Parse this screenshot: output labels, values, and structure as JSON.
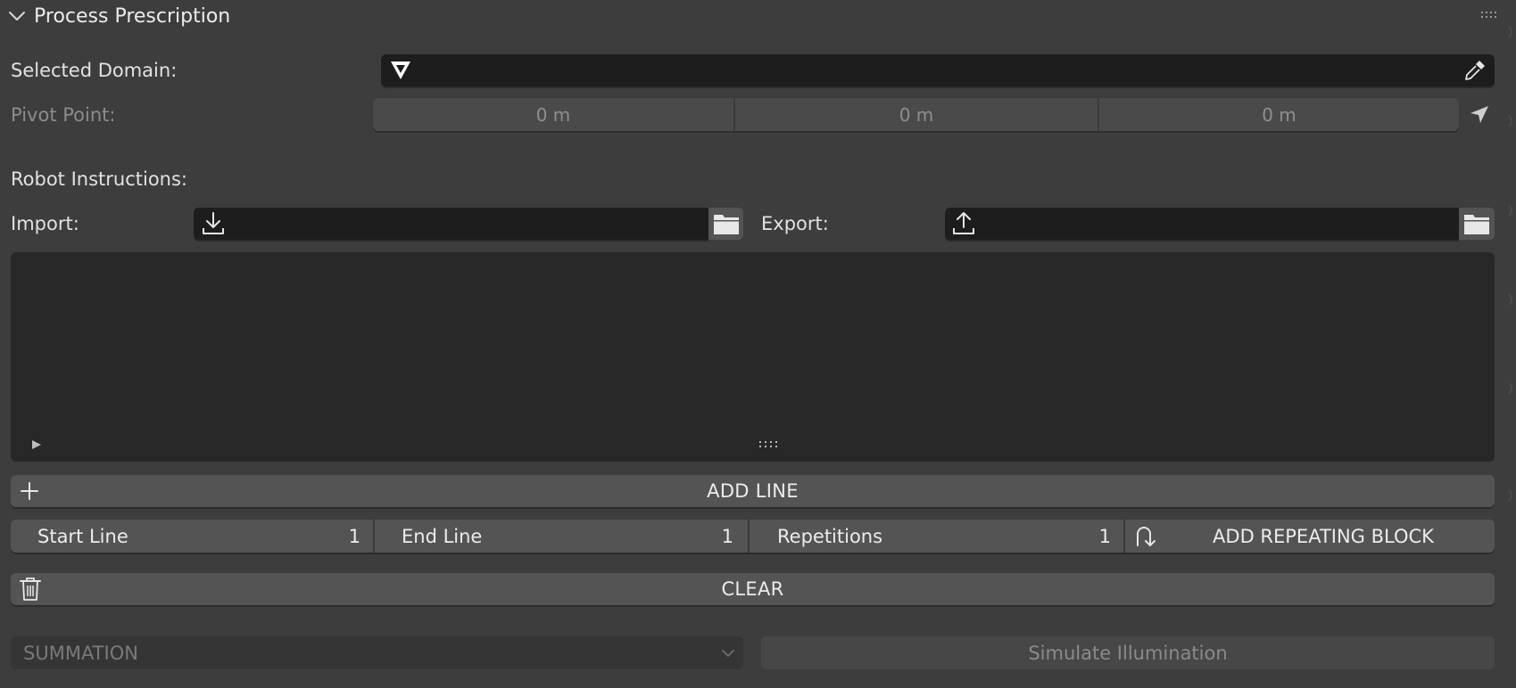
{
  "panel": {
    "title": "Process Prescription",
    "chevron_icon": "chevron-down-icon",
    "drag_handle_icon": "drag-grip-icon"
  },
  "selected_domain": {
    "label": "Selected Domain:",
    "value": "",
    "leading_icon": "mesh-triangle-icon",
    "picker_icon": "eyedropper-icon"
  },
  "pivot_point": {
    "label": "Pivot Point:",
    "values": [
      "0 m",
      "0 m",
      "0 m"
    ],
    "pick_icon": "cursor-arrow-icon"
  },
  "robot_instructions": {
    "label": "Robot Instructions:",
    "import_label": "Import:",
    "import_value": "",
    "import_icon": "download-icon",
    "export_label": "Export:",
    "export_value": "",
    "export_icon": "upload-icon",
    "folder_icon": "folder-icon"
  },
  "list": {
    "items": [],
    "expand_icon": "play-triangle-icon",
    "resize_icon": "resize-grip-icon"
  },
  "actions": {
    "add_line": "ADD LINE",
    "add_line_icon": "plus-icon",
    "start_line_label": "Start Line",
    "start_line_value": "1",
    "end_line_label": "End Line",
    "end_line_value": "1",
    "repetitions_label": "Repetitions",
    "repetitions_value": "1",
    "add_repeating_block": "ADD REPEATING BLOCK",
    "repeat_icon": "loop-arrow-icon",
    "clear": "CLEAR",
    "clear_icon": "trash-icon"
  },
  "footer": {
    "mode_select_value": "SUMMATION",
    "simulate_button": "Simulate Illumination"
  },
  "colors": {
    "panel_bg": "#3d3d3d",
    "field_dark": "#1d1d1d",
    "button_bg": "#545454",
    "text": "#e2e2e2",
    "text_disabled": "#8c8c8c"
  }
}
